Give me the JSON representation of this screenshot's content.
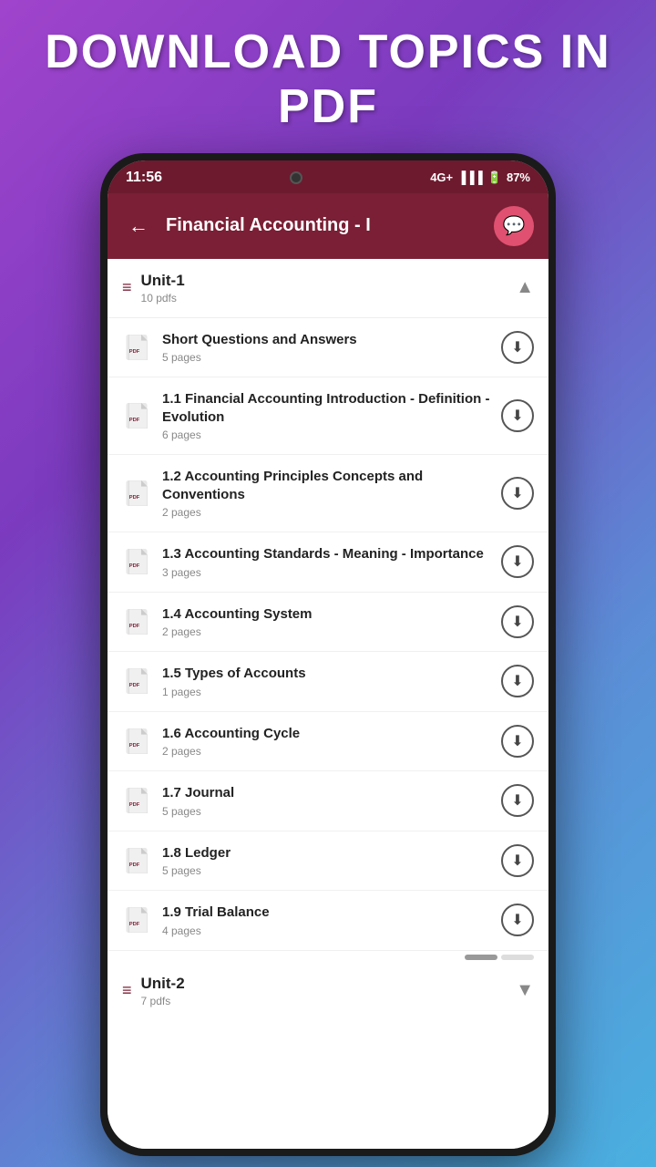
{
  "banner": {
    "text": "DOWNLOAD TOPICS IN PDF"
  },
  "statusBar": {
    "time": "11:56",
    "network": "4G+",
    "battery": "87%"
  },
  "appBar": {
    "title": "Financial Accounting - I",
    "backLabel": "←",
    "chatIconLabel": "💬"
  },
  "unit1": {
    "title": "Unit-1",
    "subtitle": "10 pdfs",
    "chevron": "▲"
  },
  "items": [
    {
      "title": "Short Questions and Answers",
      "pages": "5 pages"
    },
    {
      "title": "1.1 Financial Accounting Introduction - Definition - Evolution",
      "pages": "6 pages"
    },
    {
      "title": "1.2 Accounting Principles Concepts and Conventions",
      "pages": "2 pages"
    },
    {
      "title": "1.3 Accounting Standards - Meaning - Importance",
      "pages": "3 pages"
    },
    {
      "title": "1.4 Accounting System",
      "pages": "2 pages"
    },
    {
      "title": "1.5 Types of Accounts",
      "pages": "1 pages"
    },
    {
      "title": "1.6 Accounting Cycle",
      "pages": "2 pages"
    },
    {
      "title": "1.7 Journal",
      "pages": "5 pages"
    },
    {
      "title": "1.8 Ledger",
      "pages": "5 pages"
    },
    {
      "title": "1.9 Trial Balance",
      "pages": "4 pages"
    }
  ],
  "unit2": {
    "title": "Unit-2",
    "subtitle": "7 pdfs",
    "chevron": "▼"
  },
  "icons": {
    "pdf": "pdf-icon",
    "download": "⬇",
    "back": "←",
    "chat": "💬",
    "menu": "≡"
  }
}
